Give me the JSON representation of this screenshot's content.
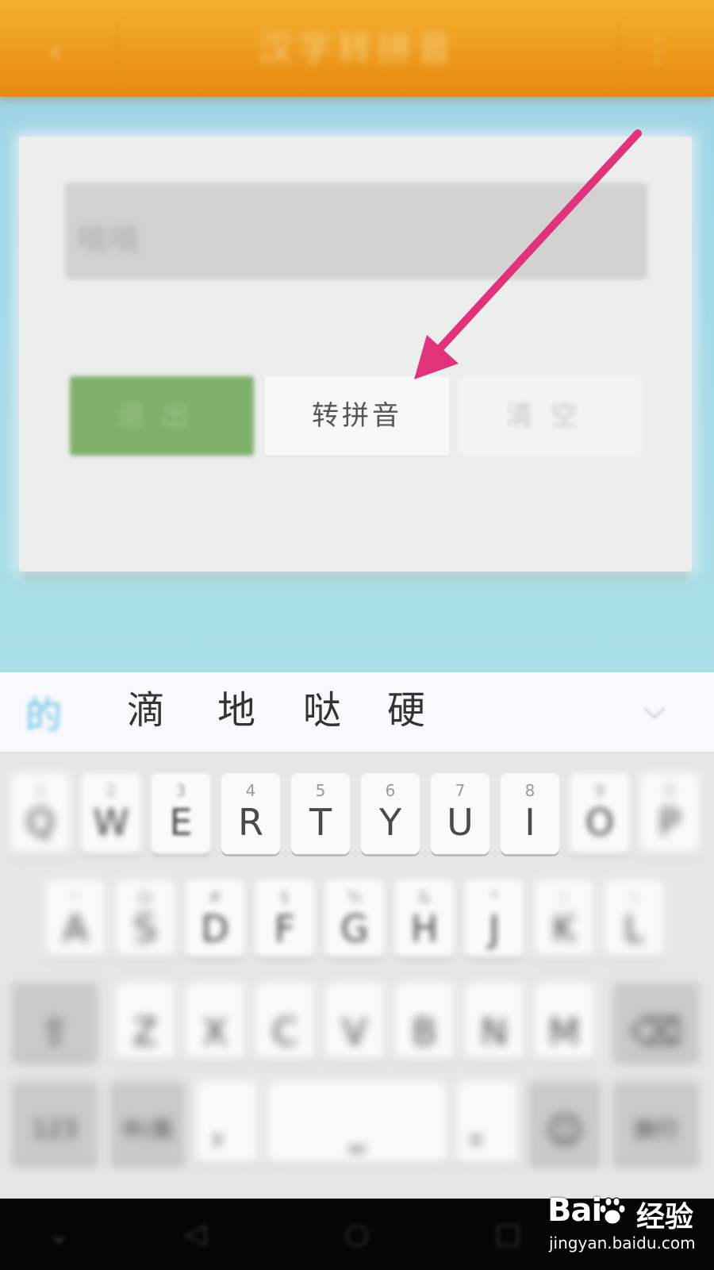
{
  "header": {
    "title": "汉字转拼音",
    "back_icon": "back-arrow-icon",
    "menu_icon": "menu-icon"
  },
  "form": {
    "input_value": "嘀嘀",
    "buttons": {
      "exit_label": "退出",
      "convert_label": "转拼音",
      "clear_label": "清空"
    }
  },
  "ime": {
    "pinyin": "的",
    "candidates": [
      "滴",
      "地",
      "哒",
      "硬"
    ],
    "collapse_icon": "chevron-down-icon"
  },
  "keyboard": {
    "row1": [
      {
        "letter": "Q",
        "sub": "1"
      },
      {
        "letter": "W",
        "sub": "2"
      },
      {
        "letter": "E",
        "sub": "3"
      },
      {
        "letter": "R",
        "sub": "4"
      },
      {
        "letter": "T",
        "sub": "5"
      },
      {
        "letter": "Y",
        "sub": "6"
      },
      {
        "letter": "U",
        "sub": "7"
      },
      {
        "letter": "I",
        "sub": "8"
      },
      {
        "letter": "O",
        "sub": "9"
      },
      {
        "letter": "P",
        "sub": "0"
      }
    ],
    "row2": [
      {
        "letter": "A",
        "sub": "!"
      },
      {
        "letter": "S",
        "sub": "@"
      },
      {
        "letter": "D",
        "sub": "#"
      },
      {
        "letter": "F",
        "sub": "$"
      },
      {
        "letter": "G",
        "sub": "%"
      },
      {
        "letter": "H",
        "sub": "&"
      },
      {
        "letter": "J",
        "sub": "*"
      },
      {
        "letter": "K",
        "sub": "("
      },
      {
        "letter": "L",
        "sub": ")"
      }
    ],
    "row3": [
      "Z",
      "X",
      "C",
      "V",
      "B",
      "N",
      "M"
    ],
    "row4": {
      "symbols_label": "123",
      "lang_label": "中/英",
      "comma": "，",
      "space_label": "",
      "period": "。",
      "enter_label": "换行"
    }
  },
  "watermark": {
    "brand": "Bai",
    "product": "经验",
    "url": "jingyan.baidu.com"
  },
  "colors": {
    "header_orange": "#ed9a1c",
    "content_blue": "#a6dbe8",
    "exit_green": "#7fb06b",
    "arrow_pink": "#e0337a"
  }
}
